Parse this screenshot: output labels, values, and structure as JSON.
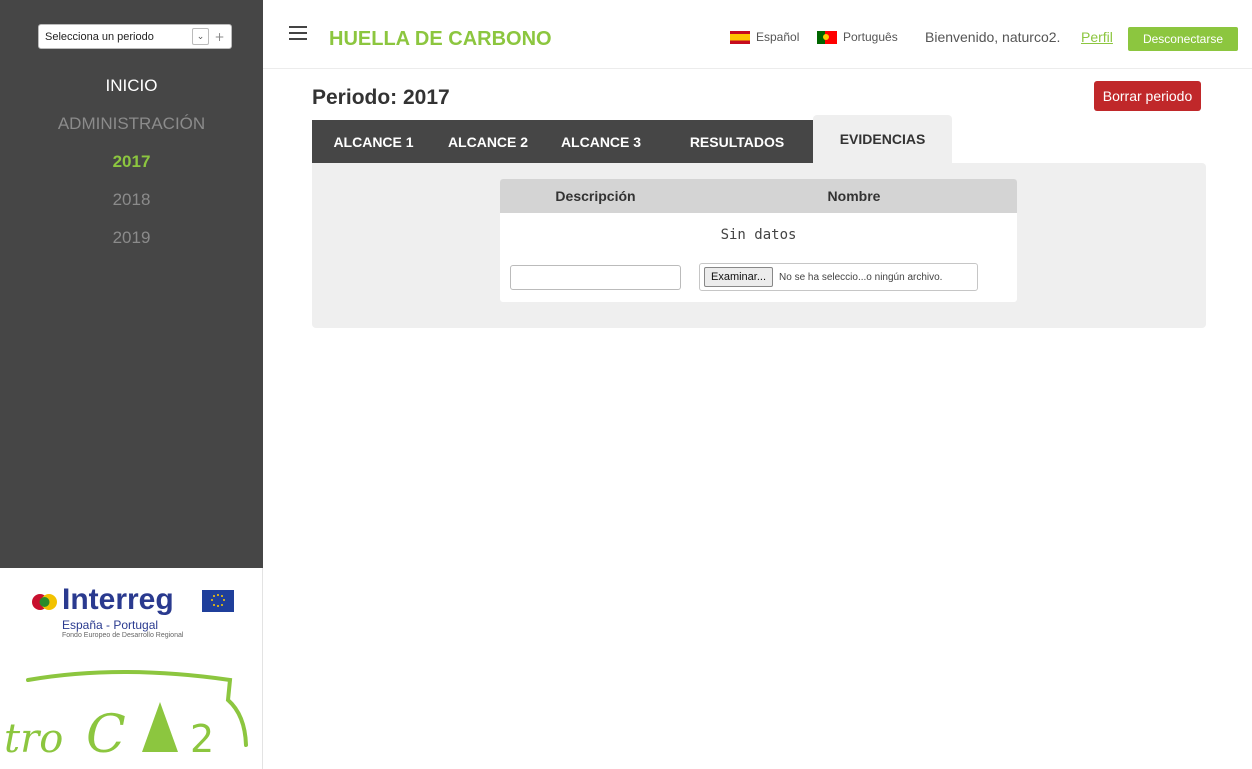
{
  "sidebar": {
    "period_select": {
      "value": "Selecciona un periodo",
      "arrow": "⌄",
      "plus": "+"
    },
    "nav": {
      "inicio": "INICIO",
      "admin": "ADMINISTRACIÓN",
      "years": [
        "2017",
        "2018",
        "2019"
      ],
      "active_year": "2017"
    },
    "logos": {
      "interreg_word": "Interreg",
      "interreg_sub": "España - Portugal",
      "interreg_fund": "Fondo Europeo de Desarrollo Regional",
      "troco_word": "troCO2"
    }
  },
  "header": {
    "title": "HUELLA DE CARBONO",
    "lang_es": "Español",
    "lang_pt": "Português",
    "welcome": "Bienvenido, naturco2.",
    "profile_link": "Perfil",
    "logout_label": "Desconectarse"
  },
  "main": {
    "period_title": "Periodo: 2017",
    "delete_label": "Borrar periodo",
    "tabs": [
      "ALCANCE 1",
      "ALCANCE 2",
      "ALCANCE 3",
      "RESULTADOS",
      "EVIDENCIAS"
    ],
    "active_tab": "EVIDENCIAS",
    "table": {
      "columns": [
        "Descripción",
        "Nombre"
      ],
      "empty_text": "Sin datos"
    },
    "upload": {
      "description_value": "",
      "browse_label": "Examinar...",
      "file_status": "No se ha seleccio...o ningún archivo."
    }
  },
  "colors": {
    "accent_green": "#8cc63f",
    "sidebar_bg": "#464646",
    "danger_red": "#c0282a"
  }
}
